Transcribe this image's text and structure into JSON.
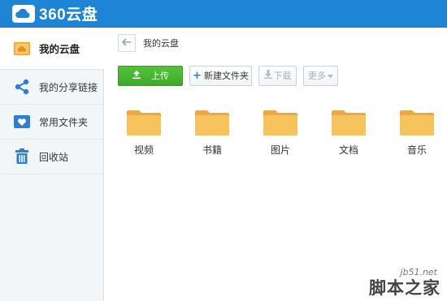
{
  "app": {
    "title": "360云盘"
  },
  "colors": {
    "header": "#1e84d6",
    "accent": "#2d7fd1",
    "upload_green": "#46b12f",
    "folder": "#f6c35c"
  },
  "sidebar": {
    "items": [
      {
        "label": "我的云盘",
        "icon": "cloud-folder-icon",
        "active": true
      },
      {
        "label": "我的分享链接",
        "icon": "share-icon",
        "active": false
      },
      {
        "label": "常用文件夹",
        "icon": "heart-folder-icon",
        "active": false
      },
      {
        "label": "回收站",
        "icon": "trash-icon",
        "active": false
      }
    ]
  },
  "breadcrumb": {
    "back_icon": "arrow-left-icon",
    "current": "我的云盘"
  },
  "toolbar": {
    "upload_label": "上传",
    "new_folder_label": "新建文件夹",
    "download_label": "下载",
    "more_label": "更多"
  },
  "folders": [
    {
      "name": "视频"
    },
    {
      "name": "书籍"
    },
    {
      "name": "图片"
    },
    {
      "name": "文档"
    },
    {
      "name": "音乐"
    }
  ],
  "watermark": {
    "url": "jb51.net",
    "site": "脚本之家"
  }
}
